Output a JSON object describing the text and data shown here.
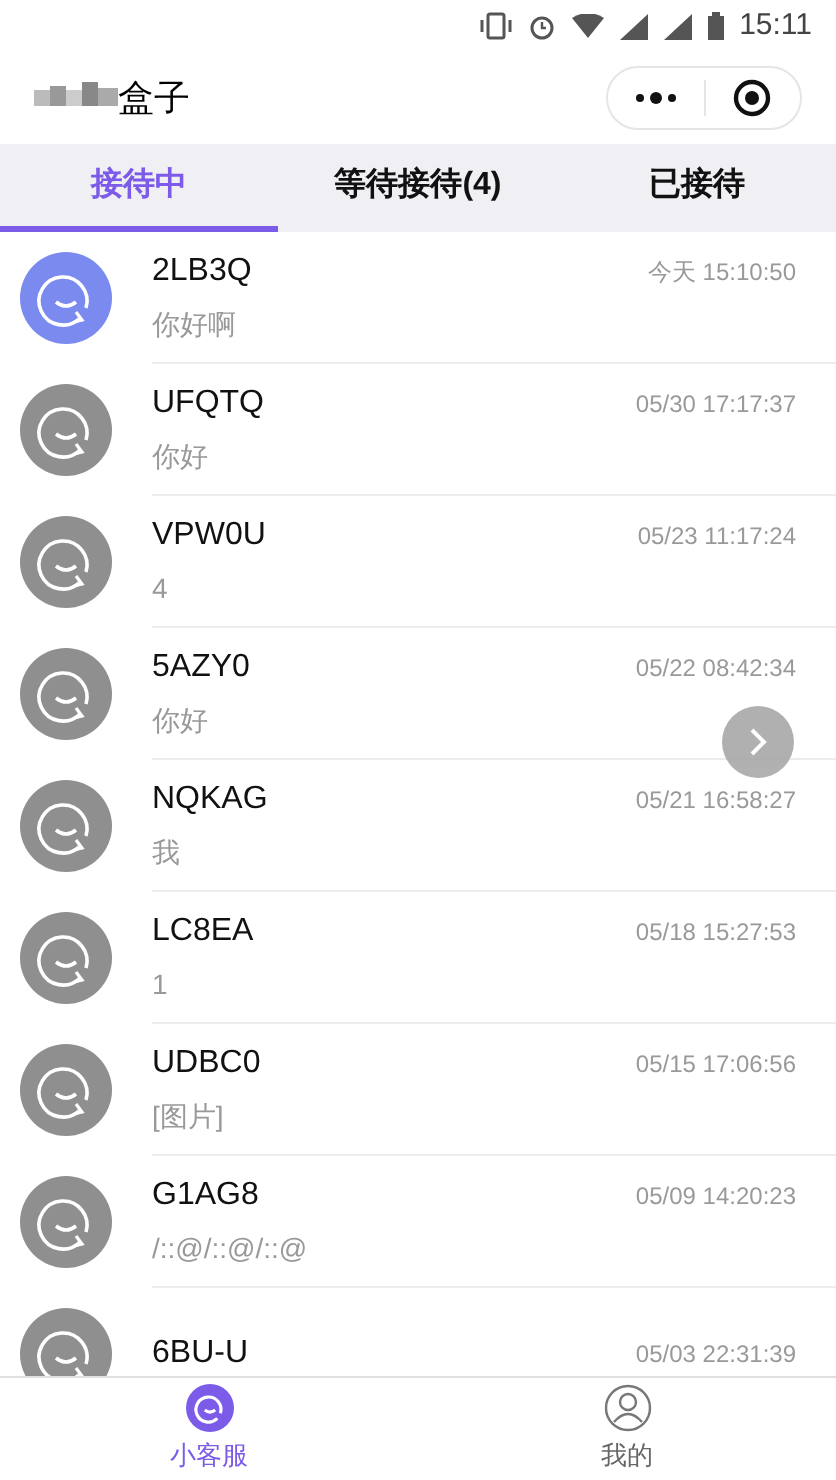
{
  "status_bar": {
    "time": "15:11"
  },
  "nav": {
    "title": "盒子"
  },
  "tabs": [
    {
      "label": "接待中",
      "selected": true
    },
    {
      "label": "等待接待(4)",
      "selected": false
    },
    {
      "label": "已接待",
      "selected": false
    }
  ],
  "conversations": [
    {
      "name": "2LB3Q",
      "time": "今天 15:10:50",
      "message": "你好啊",
      "active": true
    },
    {
      "name": "UFQTQ",
      "time": "05/30 17:17:37",
      "message": "你好",
      "active": false
    },
    {
      "name": "VPW0U",
      "time": "05/23 11:17:24",
      "message": "4",
      "active": false
    },
    {
      "name": "5AZY0",
      "time": "05/22 08:42:34",
      "message": "你好",
      "active": false
    },
    {
      "name": "NQKAG",
      "time": "05/21 16:58:27",
      "message": "我",
      "active": false
    },
    {
      "name": "LC8EA",
      "time": "05/18 15:27:53",
      "message": "1",
      "active": false
    },
    {
      "name": "UDBC0",
      "time": "05/15 17:06:56",
      "message": "[图片]",
      "active": false
    },
    {
      "name": "G1AG8",
      "time": "05/09 14:20:23",
      "message": "/::@/::@/::@",
      "active": false
    },
    {
      "name": "6BU-U",
      "time": "05/03 22:31:39",
      "active": false
    }
  ],
  "bottom_tabs": [
    {
      "label": "小客服",
      "selected": true,
      "kind": "service"
    },
    {
      "label": "我的",
      "selected": false,
      "kind": "profile"
    }
  ]
}
